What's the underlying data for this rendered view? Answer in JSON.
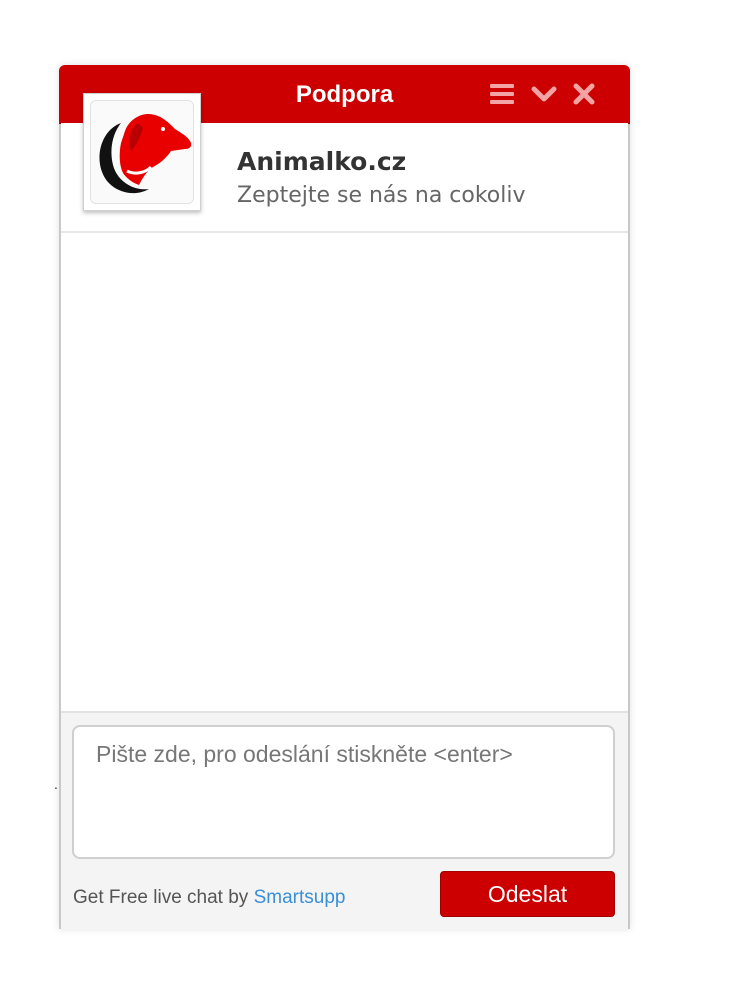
{
  "window": {
    "title": "Podpora",
    "accent_color": "#cc0000",
    "controls": {
      "menu_icon": "hamburger-menu-icon",
      "minimize_icon": "chevron-down-icon",
      "close_icon": "close-icon"
    }
  },
  "company": {
    "name": "Animalko.cz",
    "tagline": "Zeptejte se nás na cokoliv",
    "logo_icon": "red-dog-head-logo"
  },
  "composer": {
    "placeholder": "Pište zde, pro odeslání stiskněte <enter>",
    "value": "",
    "send_label": "Odeslat"
  },
  "branding": {
    "prefix": "Get Free live chat by ",
    "link_text": "Smartsupp",
    "link_color": "#3a8fd6"
  },
  "misc": {
    "stray_dot": "."
  }
}
